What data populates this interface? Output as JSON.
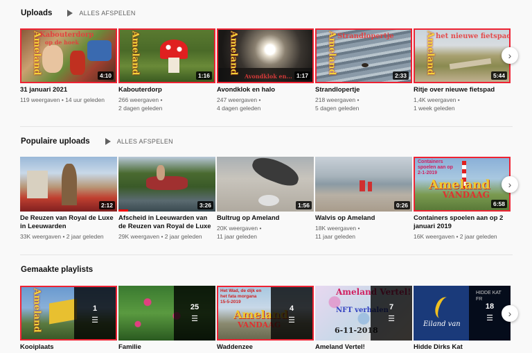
{
  "sections": {
    "uploads": {
      "title": "Uploads",
      "play_all": "ALLES AFSPELEN",
      "videos": [
        {
          "title": "31 januari 2021",
          "views": "119 weergaven",
          "age": "14 uur geleden",
          "duration": "4:10",
          "overlay": "Kabouterdorp",
          "overlay2": "op de hoek"
        },
        {
          "title": "Kabouterdorp",
          "views": "266 weergaven",
          "age": "2 dagen geleden",
          "duration": "1:16"
        },
        {
          "title": "Avondklok en halo",
          "views": "247 weergaven",
          "age": "4 dagen geleden",
          "duration": "1:17",
          "overlay": "Avondklok en..."
        },
        {
          "title": "Strandlopertje",
          "views": "218 weergaven",
          "age": "5 dagen geleden",
          "duration": "2:33",
          "overlay": "Strandlopertje"
        },
        {
          "title": "Ritje over nieuwe fietspad",
          "views": "1,4K weergaven",
          "age": "1 week geleden",
          "duration": "5:44",
          "overlay": "het nieuwe fietspad"
        }
      ]
    },
    "popular": {
      "title": "Populaire uploads",
      "play_all": "ALLES AFSPELEN",
      "videos": [
        {
          "title_line1": "De Reuzen van Royal de Luxe",
          "title_line2": "in Leeuwarden",
          "views": "33K weergaven",
          "age": "2 jaar geleden",
          "duration": "2:12"
        },
        {
          "title_line1": "Afscheid in Leeuwarden van",
          "title_line2": "de Reuzen van Royal de Luxe",
          "views": "29K weergaven",
          "age": "2 jaar geleden",
          "duration": "3:26"
        },
        {
          "title_line1": "Bultrug op Ameland",
          "title_line2": "",
          "views": "20K weergaven",
          "age": "11 jaar geleden",
          "duration": "1:56"
        },
        {
          "title_line1": "Walvis op Ameland",
          "title_line2": "",
          "views": "18K weergaven",
          "age": "11 jaar geleden",
          "duration": "0:26"
        },
        {
          "title_line1": "Containers spoelen aan op 2",
          "title_line2": "januari 2019",
          "views": "16K weergaven",
          "age": "2 jaar geleden",
          "duration": "6:58",
          "overlay": "Containers spoelen aan op 2-1-2019",
          "brand": "Ameland",
          "brand2": "VANDAAG"
        }
      ]
    },
    "playlists": {
      "title": "Gemaakte playlists",
      "items": [
        {
          "title": "Kooiplaats",
          "count": "1"
        },
        {
          "title": "Familie",
          "count": "25"
        },
        {
          "title": "Waddenzee",
          "count": "4",
          "overlay": "Het Wad, de dijk en het fata morgana 15-5-2019",
          "brand": "Ameland",
          "brand2": "VANDAAG"
        },
        {
          "title": "Ameland Vertel!",
          "count": "7",
          "overlay": "Ameland Vertel!",
          "overlay2": "NFT verhalen",
          "overlay3": "6-11-2018"
        },
        {
          "title": "Hidde Dirks Kat",
          "count": "18",
          "overlay": "Eiland van",
          "overlay2": "HIDDE KAT FR"
        }
      ]
    }
  },
  "ameland_tag": "Ameland",
  "icons": {
    "play": "play-triangle-icon",
    "next": "chevron-right-icon",
    "playlist": "playlist-icon"
  }
}
